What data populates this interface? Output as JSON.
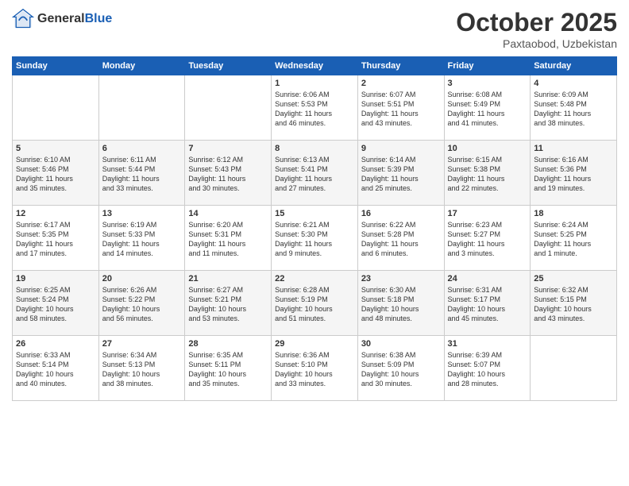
{
  "header": {
    "logo_line1": "General",
    "logo_line2": "Blue",
    "month": "October 2025",
    "location": "Paxtaobod, Uzbekistan"
  },
  "days_of_week": [
    "Sunday",
    "Monday",
    "Tuesday",
    "Wednesday",
    "Thursday",
    "Friday",
    "Saturday"
  ],
  "weeks": [
    [
      {
        "day": "",
        "content": ""
      },
      {
        "day": "",
        "content": ""
      },
      {
        "day": "",
        "content": ""
      },
      {
        "day": "1",
        "content": "Sunrise: 6:06 AM\nSunset: 5:53 PM\nDaylight: 11 hours\nand 46 minutes."
      },
      {
        "day": "2",
        "content": "Sunrise: 6:07 AM\nSunset: 5:51 PM\nDaylight: 11 hours\nand 43 minutes."
      },
      {
        "day": "3",
        "content": "Sunrise: 6:08 AM\nSunset: 5:49 PM\nDaylight: 11 hours\nand 41 minutes."
      },
      {
        "day": "4",
        "content": "Sunrise: 6:09 AM\nSunset: 5:48 PM\nDaylight: 11 hours\nand 38 minutes."
      }
    ],
    [
      {
        "day": "5",
        "content": "Sunrise: 6:10 AM\nSunset: 5:46 PM\nDaylight: 11 hours\nand 35 minutes."
      },
      {
        "day": "6",
        "content": "Sunrise: 6:11 AM\nSunset: 5:44 PM\nDaylight: 11 hours\nand 33 minutes."
      },
      {
        "day": "7",
        "content": "Sunrise: 6:12 AM\nSunset: 5:43 PM\nDaylight: 11 hours\nand 30 minutes."
      },
      {
        "day": "8",
        "content": "Sunrise: 6:13 AM\nSunset: 5:41 PM\nDaylight: 11 hours\nand 27 minutes."
      },
      {
        "day": "9",
        "content": "Sunrise: 6:14 AM\nSunset: 5:39 PM\nDaylight: 11 hours\nand 25 minutes."
      },
      {
        "day": "10",
        "content": "Sunrise: 6:15 AM\nSunset: 5:38 PM\nDaylight: 11 hours\nand 22 minutes."
      },
      {
        "day": "11",
        "content": "Sunrise: 6:16 AM\nSunset: 5:36 PM\nDaylight: 11 hours\nand 19 minutes."
      }
    ],
    [
      {
        "day": "12",
        "content": "Sunrise: 6:17 AM\nSunset: 5:35 PM\nDaylight: 11 hours\nand 17 minutes."
      },
      {
        "day": "13",
        "content": "Sunrise: 6:19 AM\nSunset: 5:33 PM\nDaylight: 11 hours\nand 14 minutes."
      },
      {
        "day": "14",
        "content": "Sunrise: 6:20 AM\nSunset: 5:31 PM\nDaylight: 11 hours\nand 11 minutes."
      },
      {
        "day": "15",
        "content": "Sunrise: 6:21 AM\nSunset: 5:30 PM\nDaylight: 11 hours\nand 9 minutes."
      },
      {
        "day": "16",
        "content": "Sunrise: 6:22 AM\nSunset: 5:28 PM\nDaylight: 11 hours\nand 6 minutes."
      },
      {
        "day": "17",
        "content": "Sunrise: 6:23 AM\nSunset: 5:27 PM\nDaylight: 11 hours\nand 3 minutes."
      },
      {
        "day": "18",
        "content": "Sunrise: 6:24 AM\nSunset: 5:25 PM\nDaylight: 11 hours\nand 1 minute."
      }
    ],
    [
      {
        "day": "19",
        "content": "Sunrise: 6:25 AM\nSunset: 5:24 PM\nDaylight: 10 hours\nand 58 minutes."
      },
      {
        "day": "20",
        "content": "Sunrise: 6:26 AM\nSunset: 5:22 PM\nDaylight: 10 hours\nand 56 minutes."
      },
      {
        "day": "21",
        "content": "Sunrise: 6:27 AM\nSunset: 5:21 PM\nDaylight: 10 hours\nand 53 minutes."
      },
      {
        "day": "22",
        "content": "Sunrise: 6:28 AM\nSunset: 5:19 PM\nDaylight: 10 hours\nand 51 minutes."
      },
      {
        "day": "23",
        "content": "Sunrise: 6:30 AM\nSunset: 5:18 PM\nDaylight: 10 hours\nand 48 minutes."
      },
      {
        "day": "24",
        "content": "Sunrise: 6:31 AM\nSunset: 5:17 PM\nDaylight: 10 hours\nand 45 minutes."
      },
      {
        "day": "25",
        "content": "Sunrise: 6:32 AM\nSunset: 5:15 PM\nDaylight: 10 hours\nand 43 minutes."
      }
    ],
    [
      {
        "day": "26",
        "content": "Sunrise: 6:33 AM\nSunset: 5:14 PM\nDaylight: 10 hours\nand 40 minutes."
      },
      {
        "day": "27",
        "content": "Sunrise: 6:34 AM\nSunset: 5:13 PM\nDaylight: 10 hours\nand 38 minutes."
      },
      {
        "day": "28",
        "content": "Sunrise: 6:35 AM\nSunset: 5:11 PM\nDaylight: 10 hours\nand 35 minutes."
      },
      {
        "day": "29",
        "content": "Sunrise: 6:36 AM\nSunset: 5:10 PM\nDaylight: 10 hours\nand 33 minutes."
      },
      {
        "day": "30",
        "content": "Sunrise: 6:38 AM\nSunset: 5:09 PM\nDaylight: 10 hours\nand 30 minutes."
      },
      {
        "day": "31",
        "content": "Sunrise: 6:39 AM\nSunset: 5:07 PM\nDaylight: 10 hours\nand 28 minutes."
      },
      {
        "day": "",
        "content": ""
      }
    ]
  ]
}
